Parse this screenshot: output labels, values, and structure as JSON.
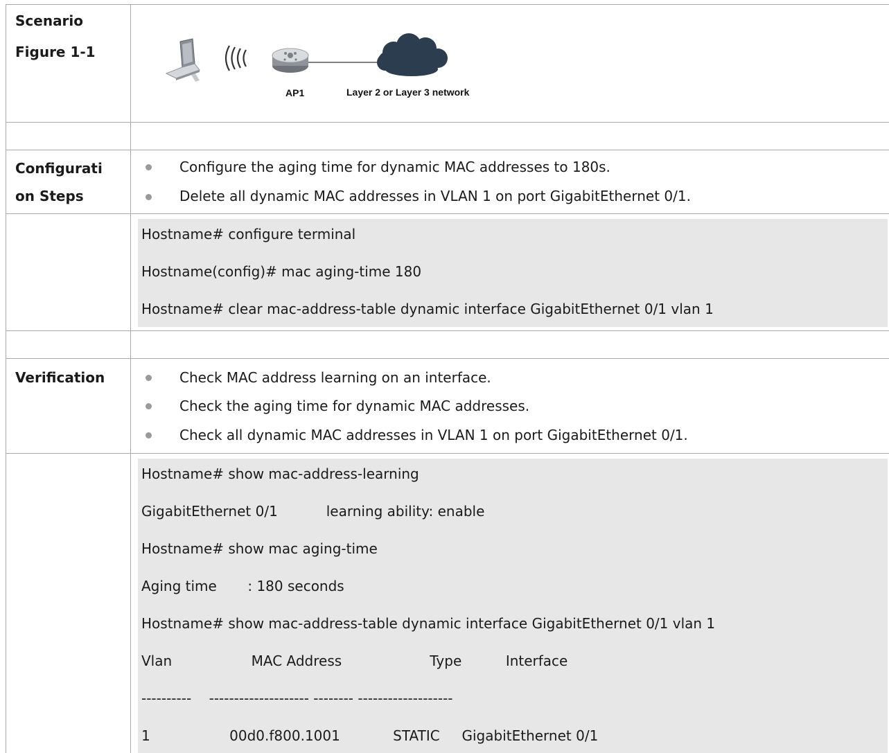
{
  "rows": {
    "scenario": {
      "label_line1": "Scenario",
      "label_line2": "Figure 1-1",
      "figure": {
        "ap_label": "AP1",
        "network_label": "Layer 2 or Layer 3 network"
      }
    },
    "configuration": {
      "label_line1": "Configurati",
      "label_line2": "on Steps",
      "bullets": [
        "Configure the aging time for dynamic MAC addresses to 180s.",
        "Delete all dynamic MAC addresses in VLAN 1 on port GigabitEthernet 0/1."
      ],
      "code": [
        "Hostname# configure terminal",
        "Hostname(config)# mac aging-time 180",
        "Hostname# clear mac-address-table dynamic interface GigabitEthernet 0/1 vlan 1"
      ]
    },
    "verification": {
      "label": "Verification",
      "bullets": [
        "Check MAC address learning on an interface.",
        "Check the aging time for dynamic MAC addresses.",
        "Check all dynamic MAC addresses in VLAN 1 on port GigabitEthernet 0/1."
      ],
      "code": [
        "Hostname# show mac-address-learning",
        "GigabitEthernet 0/1           learning ability: enable",
        "Hostname# show mac aging-time",
        "Aging time       : 180 seconds",
        "Hostname# show mac-address-table dynamic interface GigabitEthernet 0/1 vlan 1",
        "Vlan                  MAC Address                    Type          Interface",
        "----------    -------------------- -------- -------------------",
        "1                  00d0.f800.1001            STATIC     GigabitEthernet 0/1"
      ]
    }
  }
}
